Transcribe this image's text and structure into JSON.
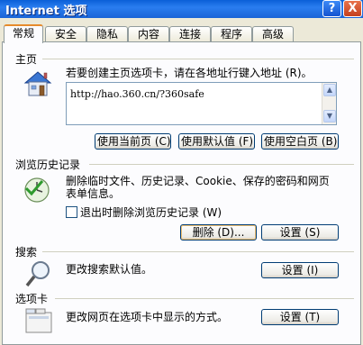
{
  "window": {
    "title": "Internet 选项",
    "help_icon_glyph": "?",
    "close_icon_glyph": "X"
  },
  "tabs": [
    {
      "label": "常规",
      "active": true
    },
    {
      "label": "安全"
    },
    {
      "label": "隐私"
    },
    {
      "label": "内容"
    },
    {
      "label": "连接"
    },
    {
      "label": "程序"
    },
    {
      "label": "高级"
    }
  ],
  "homepage": {
    "title": "主页",
    "description": "若要创建主页选项卡，请在各地址行键入地址 (R)。",
    "url": "http://hao.360.cn/?360safe",
    "buttons": {
      "use_current": "使用当前页 (C)",
      "use_default": "使用默认值 (F)",
      "use_blank": "使用空白页 (B)"
    }
  },
  "history": {
    "title": "浏览历史记录",
    "description": "删除临时文件、历史记录、Cookie、保存的密码和网页表单信息。",
    "checkbox_label": "退出时删除浏览历史记录 (W)",
    "checkbox_checked": false,
    "delete_button": "删除 (D)...",
    "settings_button": "设置 (S)"
  },
  "search": {
    "title": "搜索",
    "description": "更改搜索默认值。",
    "settings_button": "设置 (I)"
  },
  "tabs_section": {
    "title": "选项卡",
    "description": "更改网页在选项卡中显示的方式。",
    "settings_button": "设置 (T)"
  }
}
